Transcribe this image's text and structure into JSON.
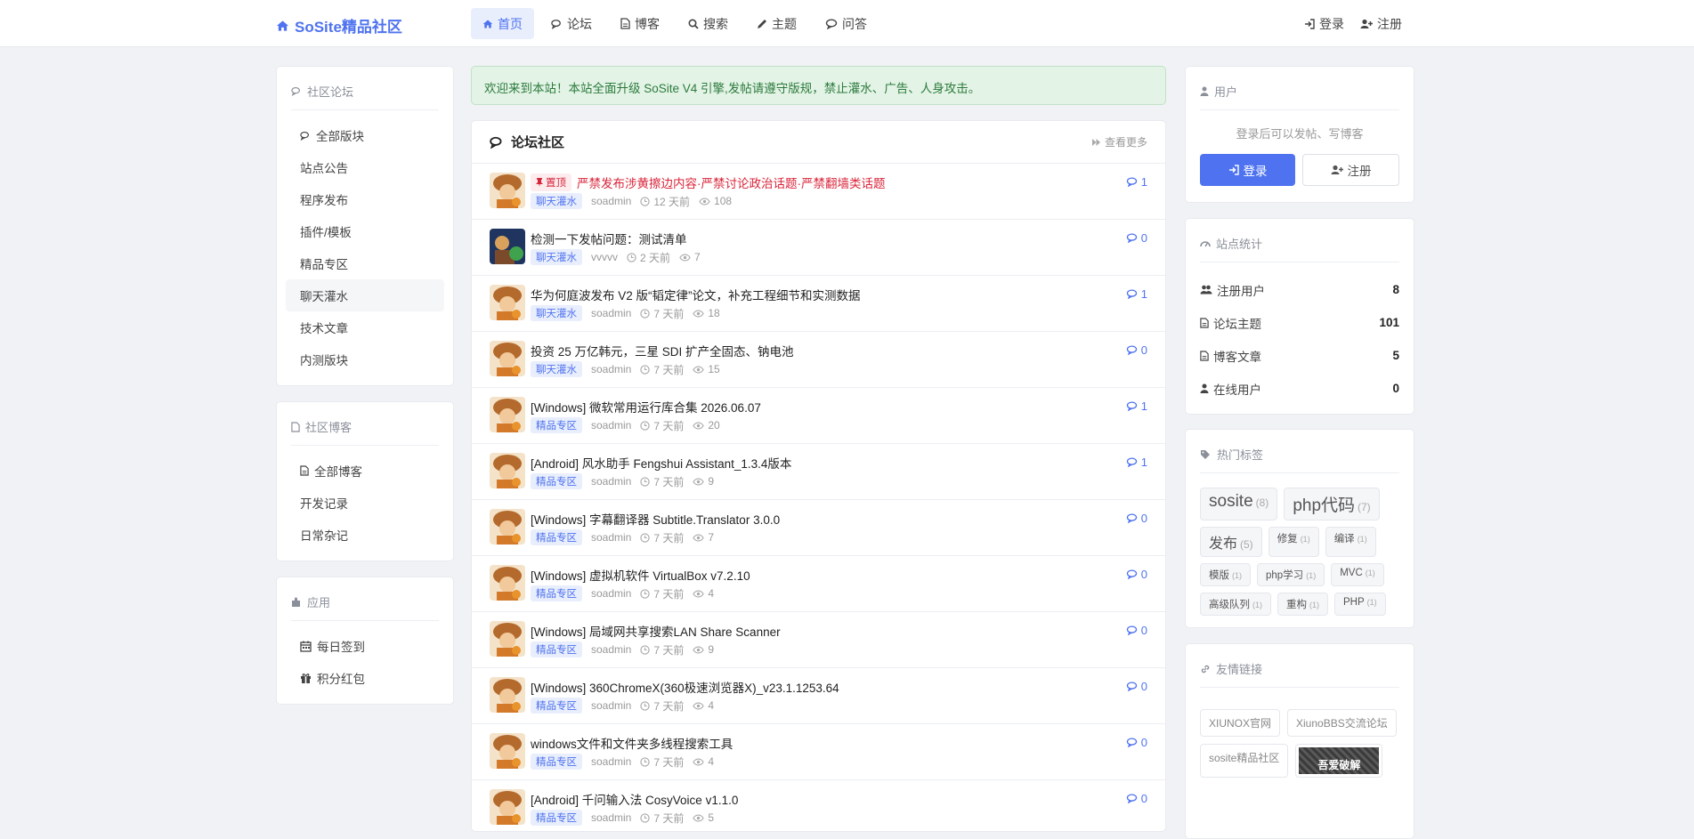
{
  "brand": {
    "name": "SoSite精品社区"
  },
  "nav": {
    "items": [
      {
        "label": "首页",
        "icon": "home-icon"
      },
      {
        "label": "论坛",
        "icon": "comments-icon"
      },
      {
        "label": "博客",
        "icon": "file-icon"
      },
      {
        "label": "搜索",
        "icon": "search-icon"
      },
      {
        "label": "主题",
        "icon": "pencil-icon"
      },
      {
        "label": "问答",
        "icon": "question-icon"
      }
    ],
    "login": "登录",
    "register": "注册"
  },
  "sidebar": {
    "forum": {
      "title": "社区论坛",
      "items": [
        "全部版块",
        "站点公告",
        "程序发布",
        "插件/模板",
        "精品专区",
        "聊天灌水",
        "技术文章",
        "内测版块"
      ]
    },
    "blog": {
      "title": "社区博客",
      "items": [
        "全部博客",
        "开发记录",
        "日常杂记"
      ]
    },
    "apps": {
      "title": "应用",
      "items": [
        "每日签到",
        "积分红包"
      ]
    }
  },
  "notice": "欢迎来到本站！本站全面升级 SoSite V4 引擎,发帖请遵守版规，禁止灌水、广告、人身攻击。",
  "forum": {
    "title": "论坛社区",
    "more": "查看更多",
    "pin_label": "置顶",
    "threads": [
      {
        "title": "严禁发布涉黄擦边内容·严禁讨论政治话题·严禁翻墙类话题",
        "tag": "聊天灌水",
        "author": "soadmin",
        "time": "12 天前",
        "views": "108",
        "replies": "1",
        "sticky": true
      },
      {
        "title": "检测一下发帖问题：测试清单",
        "tag": "聊天灌水",
        "author": "vvvvv",
        "time": "2 天前",
        "views": "7",
        "replies": "0"
      },
      {
        "title": "华为何庭波发布 V2 版“韬定律”论文，补充工程细节和实测数据",
        "tag": "聊天灌水",
        "author": "soadmin",
        "time": "7 天前",
        "views": "18",
        "replies": "1"
      },
      {
        "title": "投资 25 万亿韩元，三星 SDI 扩产全固态、钠电池",
        "tag": "聊天灌水",
        "author": "soadmin",
        "time": "7 天前",
        "views": "15",
        "replies": "0"
      },
      {
        "title": "[Windows] 微软常用运行库合集 2026.06.07",
        "tag": "精品专区",
        "author": "soadmin",
        "time": "7 天前",
        "views": "20",
        "replies": "1"
      },
      {
        "title": "[Android] 风水助手 Fengshui Assistant_1.3.4版本",
        "tag": "精品专区",
        "author": "soadmin",
        "time": "7 天前",
        "views": "9",
        "replies": "1"
      },
      {
        "title": "[Windows] 字幕翻译器 Subtitle.Translator 3.0.0",
        "tag": "精品专区",
        "author": "soadmin",
        "time": "7 天前",
        "views": "7",
        "replies": "0"
      },
      {
        "title": "[Windows] 虚拟机软件 VirtualBox v7.2.10",
        "tag": "精品专区",
        "author": "soadmin",
        "time": "7 天前",
        "views": "4",
        "replies": "0"
      },
      {
        "title": "[Windows] 局域网共享搜索LAN Share Scanner",
        "tag": "精品专区",
        "author": "soadmin",
        "time": "7 天前",
        "views": "9",
        "replies": "0"
      },
      {
        "title": "[Windows] 360ChromeX(360极速浏览器X)_v23.1.1253.64",
        "tag": "精品专区",
        "author": "soadmin",
        "time": "7 天前",
        "views": "4",
        "replies": "0"
      },
      {
        "title": "windows文件和文件夹多线程搜索工具",
        "tag": "精品专区",
        "author": "soadmin",
        "time": "7 天前",
        "views": "4",
        "replies": "0"
      },
      {
        "title": "[Android] 千问输入法 CosyVoice v1.1.0",
        "tag": "精品专区",
        "author": "soadmin",
        "time": "7 天前",
        "views": "5",
        "replies": "0"
      }
    ]
  },
  "user_panel": {
    "title": "用户",
    "hint": "登录后可以发帖、写博客",
    "login": "登录",
    "register": "注册"
  },
  "stats": {
    "title": "站点统计",
    "rows": [
      {
        "label": "注册用户",
        "value": "8",
        "icon": "users-icon"
      },
      {
        "label": "论坛主题",
        "value": "101",
        "icon": "file-icon"
      },
      {
        "label": "博客文章",
        "value": "5",
        "icon": "file-icon"
      },
      {
        "label": "在线用户",
        "value": "0",
        "icon": "user-icon"
      }
    ]
  },
  "hot_tags": {
    "title": "热门标签",
    "items": [
      {
        "name": "sosite",
        "count": "(8)",
        "size": "l"
      },
      {
        "name": "php代码",
        "count": "(7)",
        "size": "l"
      },
      {
        "name": "发布",
        "count": "(5)",
        "size": "m"
      },
      {
        "name": "修复",
        "count": "(1)",
        "size": "s"
      },
      {
        "name": "编译",
        "count": "(1)",
        "size": "s"
      },
      {
        "name": "模版",
        "count": "(1)",
        "size": "s"
      },
      {
        "name": "php学习",
        "count": "(1)",
        "size": "s"
      },
      {
        "name": "MVC",
        "count": "(1)",
        "size": "s"
      },
      {
        "name": "高级队列",
        "count": "(1)",
        "size": "s"
      },
      {
        "name": "重构",
        "count": "(1)",
        "size": "s"
      },
      {
        "name": "PHP",
        "count": "(1)",
        "size": "s"
      }
    ]
  },
  "friend_links": {
    "title": "友情链接",
    "items": [
      "XIUNOX官网",
      "XiunoBBS交流论坛",
      "sosite精品社区"
    ],
    "banner_text": "吾爱破解"
  },
  "colors": {
    "accent": "#4f73f0",
    "sticky": "#d9253a",
    "notice_bg": "#e3f4e6"
  }
}
